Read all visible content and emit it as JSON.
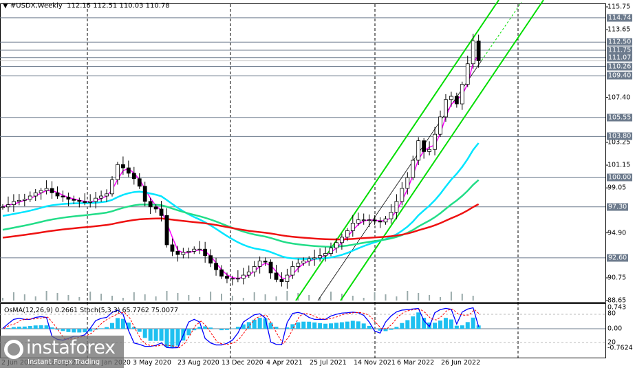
{
  "header": {
    "symbol": "#USDX,Weekly",
    "open": "112.15",
    "high": "112.51",
    "low": "110.03",
    "close": "110.78"
  },
  "price_axis": [
    "115.75",
    "113.65",
    "107.40",
    "103.25",
    "101.15",
    "99.05",
    "94.90",
    "90.75",
    "88.65"
  ],
  "levels": [
    "114.74",
    "112.50",
    "111.75",
    "111.07",
    "110.26",
    "109.40",
    "105.55",
    "103.80",
    "100.00",
    "97.30",
    "92.60"
  ],
  "dates": [
    "2 Jun 2019",
    "22 Sep 2019",
    "12 Jan 2020",
    "3 May 2020",
    "23 Aug 2020",
    "13 Dec 2020",
    "4 Apr 2021",
    "25 Jul 2021",
    "14 Nov 2021",
    "6 Mar 2022",
    "26 Jun 2022"
  ],
  "indicator": {
    "label": "OsMA(12,26,9) 0.2661  Stoch(5,3,3) 65.7762 75.0077",
    "axis": [
      "0.743",
      "80",
      "0.00",
      "20",
      "-0.7624"
    ]
  },
  "watermark": {
    "brand": "instaforex",
    "tagline": "Instant Forex Trading"
  },
  "colors": {
    "fast_ma": "#ff00ff",
    "mid_ma": "#00e5ff",
    "slow_ma": "#22dd88",
    "long_ma": "#ee1111",
    "channel": "#00dd00",
    "level": "#6d7b8d",
    "osma": "#1ec0f0",
    "stoch": "#0000ff",
    "signal": "#ff0000"
  },
  "chart_data": {
    "type": "candlestick",
    "title": "#USDX,Weekly",
    "ylim": [
      88.65,
      115.75
    ],
    "closes": [
      97.3,
      97.5,
      97.8,
      97.9,
      98.0,
      98.3,
      98.6,
      98.8,
      99.0,
      98.6,
      98.3,
      98.2,
      98.0,
      97.9,
      97.8,
      97.7,
      97.8,
      98.1,
      98.3,
      98.5,
      99.8,
      101.2,
      100.9,
      100.4,
      99.9,
      99.2,
      97.8,
      97.3,
      97.1,
      96.5,
      93.8,
      93.2,
      92.9,
      93.1,
      93.2,
      93.4,
      93.4,
      92.8,
      92.1,
      91.5,
      90.9,
      90.7,
      90.7,
      90.7,
      91.0,
      91.3,
      91.8,
      92.3,
      92.2,
      91.2,
      90.6,
      90.4,
      91.0,
      91.8,
      92.1,
      92.3,
      92.5,
      92.6,
      92.8,
      93.0,
      93.5,
      94.0,
      94.5,
      95.1,
      95.8,
      96.1,
      96.1,
      96.1,
      96.0,
      95.9,
      96.2,
      96.8,
      97.8,
      99.0,
      100.0,
      101.6,
      103.4,
      102.4,
      102.6,
      104.0,
      105.6,
      107.2,
      107.5,
      106.8,
      108.6,
      110.5,
      112.6,
      110.78
    ],
    "moving_averages": [
      {
        "color": "fast_ma",
        "period": 3,
        "start": 97.3
      },
      {
        "color": "mid_ma",
        "period": 25,
        "start": 96.4
      },
      {
        "color": "slow_ma",
        "period": 50,
        "start": 95.1
      },
      {
        "color": "long_ma",
        "period": 100,
        "start": 94.4
      }
    ]
  }
}
